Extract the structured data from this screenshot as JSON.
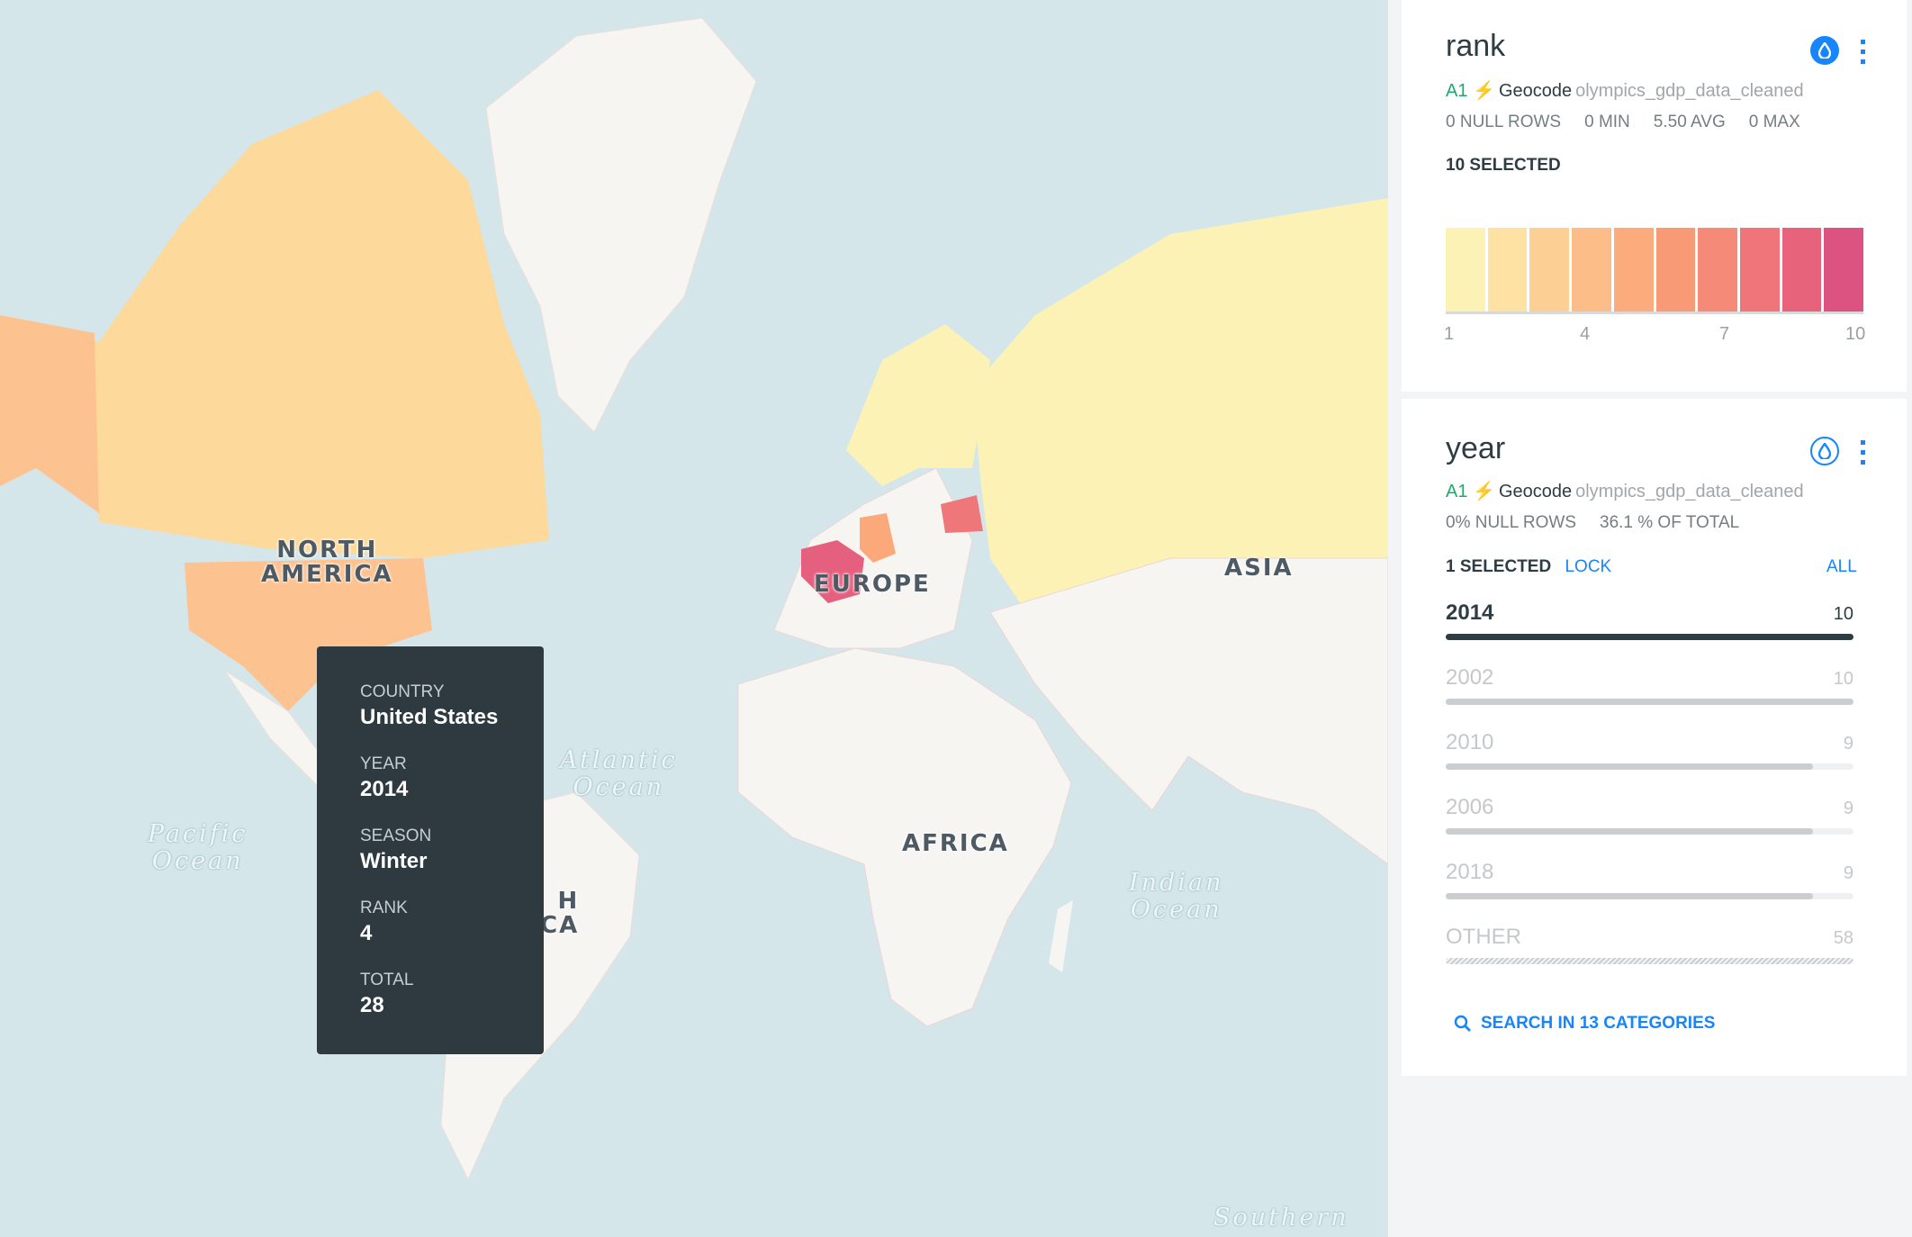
{
  "map": {
    "labels": {
      "north_america": "NORTH\nAMERICA",
      "europe": "EUROPE",
      "asia": "ASIA",
      "africa": "AFRICA",
      "south_america_partial": "H\nCA"
    },
    "oceans": {
      "atlantic": "Atlantic\nOcean",
      "pacific": "Pacific\nOcean",
      "indian": "Indian\nOcean",
      "southern": "Southern"
    }
  },
  "tooltip": {
    "fields": [
      {
        "key": "COUNTRY",
        "value": "United States"
      },
      {
        "key": "YEAR",
        "value": "2014"
      },
      {
        "key": "SEASON",
        "value": "Winter"
      },
      {
        "key": "RANK",
        "value": "4"
      },
      {
        "key": "TOTAL",
        "value": "28"
      }
    ]
  },
  "rank_widget": {
    "title": "rank",
    "source_badge": "A1",
    "geocode": "Geocode",
    "dataset": "olympics_gdp_data_cleaned",
    "stats": [
      "0 NULL ROWS",
      "0 MIN",
      "5.50 AVG",
      "0 MAX"
    ],
    "selected": "10 SELECTED",
    "histogram_colors": [
      "#fdf2b6",
      "#fde2a4",
      "#fccf94",
      "#fcbd89",
      "#fbab7c",
      "#f99a76",
      "#f68a79",
      "#f0757a",
      "#e7637b",
      "#dc5280"
    ],
    "ticks": [
      "1",
      "4",
      "7",
      "10"
    ]
  },
  "year_widget": {
    "title": "year",
    "source_badge": "A1",
    "geocode": "Geocode",
    "dataset": "olympics_gdp_data_cleaned",
    "stats": [
      "0% NULL ROWS",
      "36.1 % OF TOTAL"
    ],
    "selected": "1 SELECTED",
    "lock": "LOCK",
    "all": "ALL",
    "categories": [
      {
        "label": "2014",
        "count": "10",
        "fraction": 1.0,
        "selected": true
      },
      {
        "label": "2002",
        "count": "10",
        "fraction": 1.0,
        "selected": false
      },
      {
        "label": "2010",
        "count": "9",
        "fraction": 0.9,
        "selected": false
      },
      {
        "label": "2006",
        "count": "9",
        "fraction": 0.9,
        "selected": false
      },
      {
        "label": "2018",
        "count": "9",
        "fraction": 0.9,
        "selected": false
      },
      {
        "label": "OTHER",
        "count": "58",
        "fraction": 1.0,
        "selected": false,
        "other": true
      }
    ],
    "search": "SEARCH IN 13 CATEGORIES"
  },
  "colors": {
    "accent": "#1785fb",
    "dark": "#2e3c43",
    "badge": "#1eaa6e"
  }
}
